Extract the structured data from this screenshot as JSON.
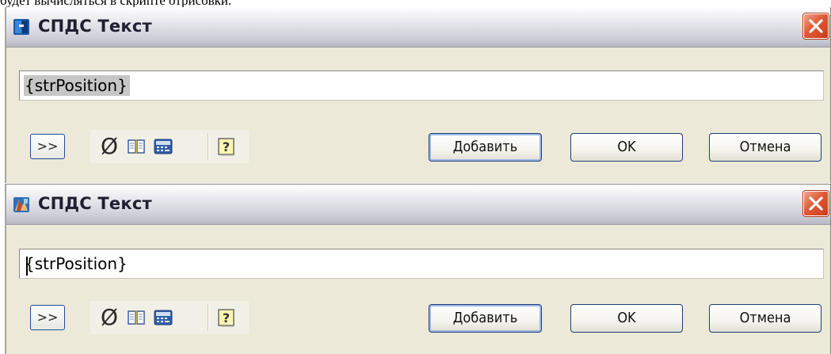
{
  "caption_fragment": "будет вычисляться в скрипте отрисовки.",
  "dialogs": [
    {
      "title": "СПДС Текст",
      "field_value": "{strPosition}",
      "expand_label": ">>",
      "tool_icons": [
        "diameter-icon",
        "book-icon",
        "calculator-icon",
        "help-icon"
      ],
      "diameter_glyph": "Ø",
      "help_glyph": "?",
      "add_label": "Добавить",
      "ok_label": "OK",
      "cancel_label": "Отмена"
    },
    {
      "title": "СПДС Текст",
      "field_value": "{strPosition}",
      "expand_label": ">>",
      "tool_icons": [
        "diameter-icon",
        "book-icon",
        "calculator-icon",
        "help-icon"
      ],
      "diameter_glyph": "Ø",
      "help_glyph": "?",
      "add_label": "Добавить",
      "ok_label": "OK",
      "cancel_label": "Отмена"
    }
  ],
  "colors": {
    "dialog_bg": "#ece9d8",
    "close_button": "#e05a36",
    "selection": "#c6c6c6",
    "button_border": "#1f3f78"
  }
}
